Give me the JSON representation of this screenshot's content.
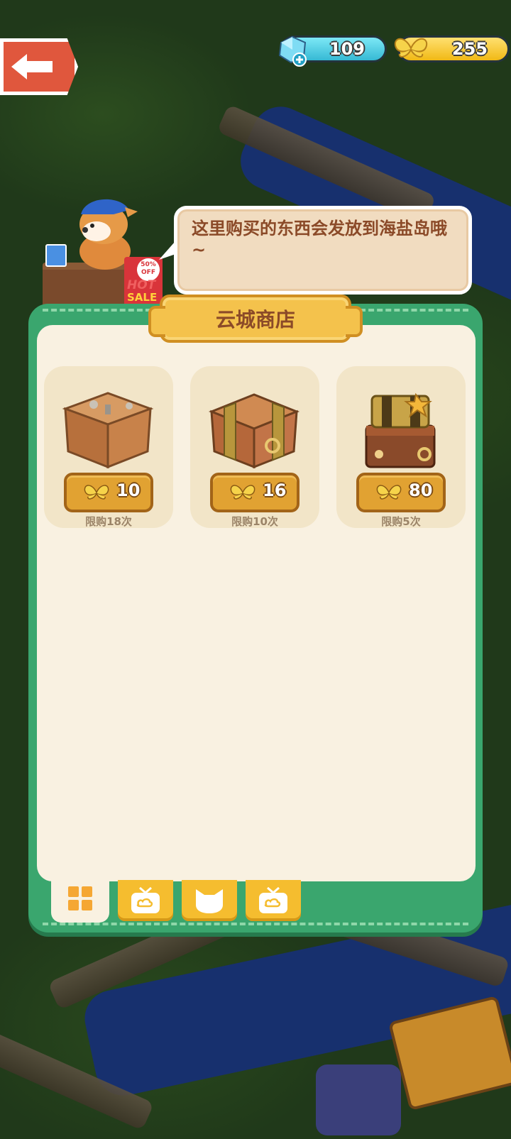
{
  "currency": {
    "gems": "109",
    "coins": "255"
  },
  "shopkeeper": {
    "sign_badge": "50% OFF",
    "sign_hot": "HOT",
    "sign_sale": "SALE"
  },
  "bubble": {
    "text": "这里购买的东西会发放到海盐岛哦~"
  },
  "shop": {
    "title": "云城商店",
    "items": [
      {
        "icon": "wooden-crate-icon",
        "price": "10",
        "limit": "限购18次"
      },
      {
        "icon": "banded-crate-icon",
        "price": "16",
        "limit": "限购10次"
      },
      {
        "icon": "treasure-chest-stack-icon",
        "price": "80",
        "limit": "限购5次"
      }
    ],
    "tabs": [
      {
        "icon": "grid-icon",
        "active": true
      },
      {
        "icon": "tv-ad-icon",
        "active": false
      },
      {
        "icon": "cat-icon",
        "active": false
      },
      {
        "icon": "tv-ad-icon",
        "active": false
      }
    ]
  },
  "colors": {
    "panel_green": "#3aa66e",
    "panel_cream": "#f9f1e1",
    "title_gold": "#f4c24c",
    "price_gold": "#e1a232",
    "text_brown": "#8b4a28"
  }
}
